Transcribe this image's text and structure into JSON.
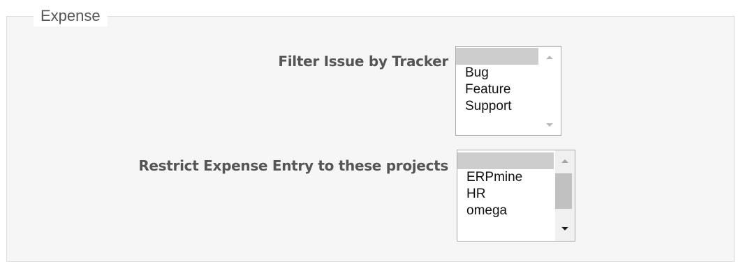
{
  "fieldset": {
    "legend": "Expense"
  },
  "tracker_filter": {
    "label": "Filter Issue by Tracker",
    "options": [
      "",
      "Bug",
      "Feature",
      "Support"
    ],
    "selected_index": 0
  },
  "project_restrict": {
    "label": "Restrict Expense Entry to these projects",
    "options": [
      "",
      "ERPmine",
      "HR",
      "omega"
    ],
    "selected_index": 0
  },
  "colors": {
    "fieldset_background": "#f6f6f6",
    "label_text": "#555555",
    "selected_option": "#cdcdcd"
  },
  "icons": [
    "scroll-up-arrow-icon",
    "scroll-down-arrow-icon"
  ]
}
